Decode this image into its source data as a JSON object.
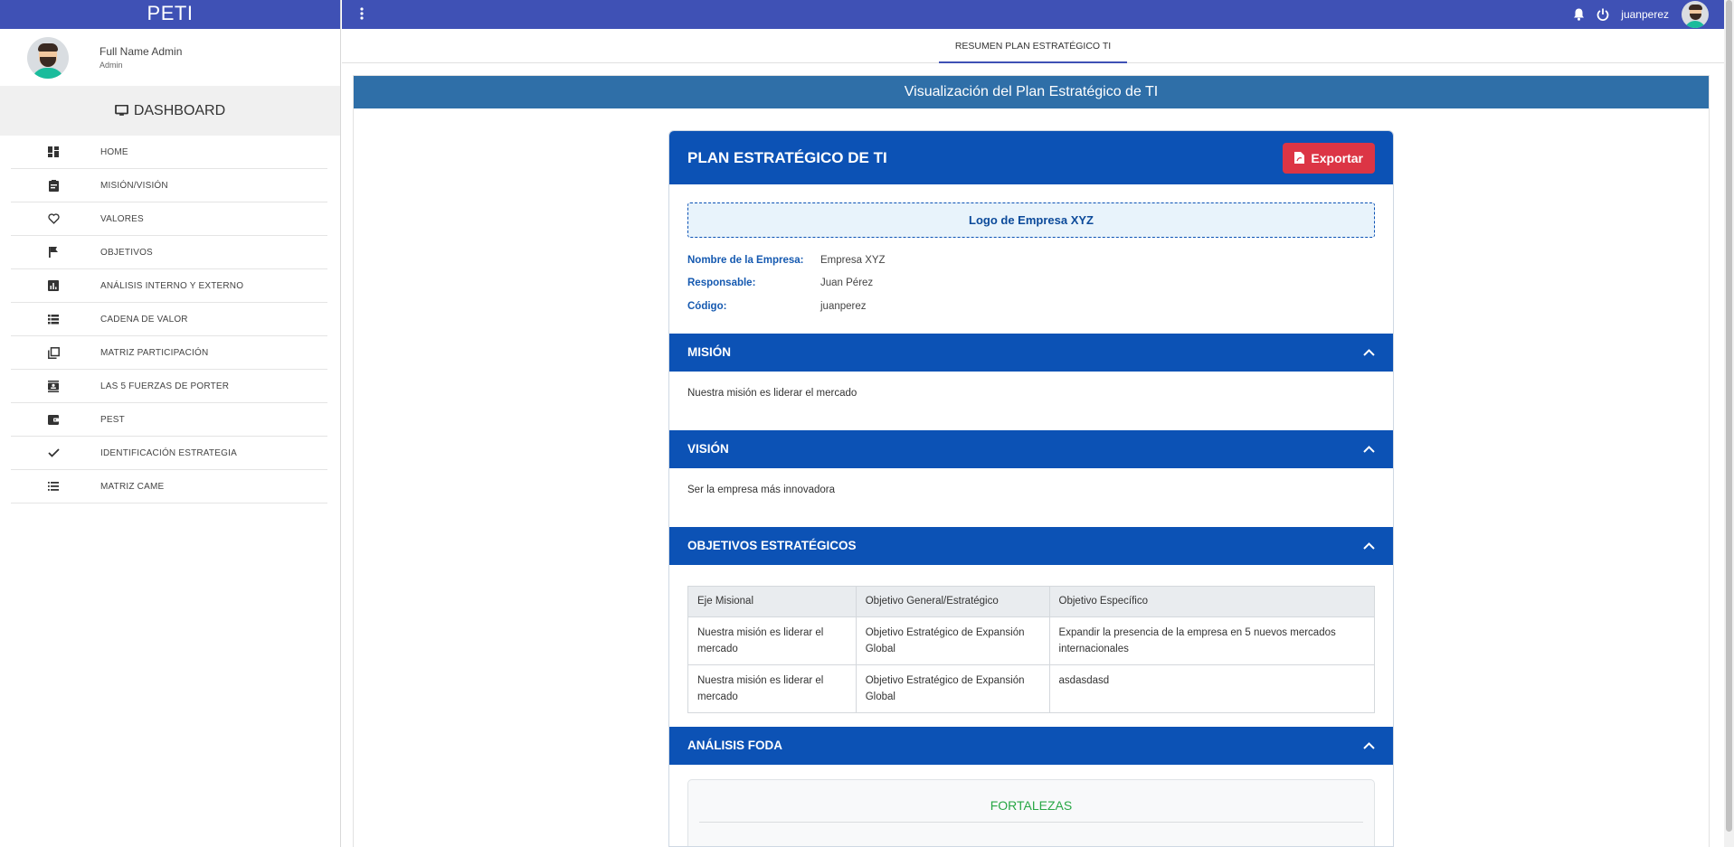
{
  "brand": "PETI",
  "user": {
    "full_name": "Full Name Admin",
    "role": "Admin",
    "username": "juanperez"
  },
  "sidebar": {
    "dashboard_label": "DASHBOARD",
    "items": [
      {
        "label": "HOME",
        "icon": "dashboard-grid-icon"
      },
      {
        "label": "MISIÓN/VISIÓN",
        "icon": "clipboard-icon"
      },
      {
        "label": "VALORES",
        "icon": "heart-icon"
      },
      {
        "label": "OBJETIVOS",
        "icon": "flag-icon"
      },
      {
        "label": "ANÁLISIS INTERNO Y EXTERNO",
        "icon": "bar-chart-icon"
      },
      {
        "label": "CADENA DE VALOR",
        "icon": "list-icon"
      },
      {
        "label": "MATRIZ PARTICIPACIÓN",
        "icon": "copy-icon"
      },
      {
        "label": "LAS 5 FUERZAS DE PORTER",
        "icon": "contact-card-icon"
      },
      {
        "label": "PEST",
        "icon": "wallet-icon"
      },
      {
        "label": "IDENTIFICACIÓN ESTRATEGIA",
        "icon": "check-icon"
      },
      {
        "label": "MATRIZ CAME",
        "icon": "bulleted-list-icon"
      }
    ]
  },
  "tabs": [
    {
      "label": "RESUMEN PLAN ESTRATÉGICO TI",
      "active": true
    }
  ],
  "main": {
    "panel_title": "Visualización del Plan Estratégico de TI",
    "plan_title": "PLAN ESTRATÉGICO DE TI",
    "export_label": "Exportar",
    "logo_text": "Logo de Empresa XYZ",
    "info": [
      {
        "key": "Nombre de la Empresa:",
        "value": "Empresa XYZ"
      },
      {
        "key": "Responsable:",
        "value": "Juan Pérez"
      },
      {
        "key": "Código:",
        "value": "juanperez"
      }
    ],
    "mision": {
      "title": "MISIÓN",
      "text": "Nuestra misión es liderar el mercado"
    },
    "vision": {
      "title": "VISIÓN",
      "text": "Ser la empresa más innovadora"
    },
    "objetivos": {
      "title": "OBJETIVOS ESTRATÉGICOS",
      "headers": [
        "Eje Misional",
        "Objetivo General/Estratégico",
        "Objetivo Específico"
      ],
      "rows": [
        [
          "Nuestra misión es liderar el mercado",
          "Objetivo Estratégico de Expansión Global",
          "Expandir la presencia de la empresa en 5 nuevos mercados internacionales"
        ],
        [
          "Nuestra misión es liderar el mercado",
          "Objetivo Estratégico de Expansión Global",
          "asdasdasd"
        ]
      ]
    },
    "foda": {
      "title": "ANÁLISIS FODA",
      "fortalezas_title": "FORTALEZAS"
    }
  },
  "colors": {
    "topbar": "#3f51b5",
    "section": "#0c52b5",
    "export": "#dc3545",
    "panel_header": "#2f6fa8",
    "fortalezas": "#28a745"
  }
}
